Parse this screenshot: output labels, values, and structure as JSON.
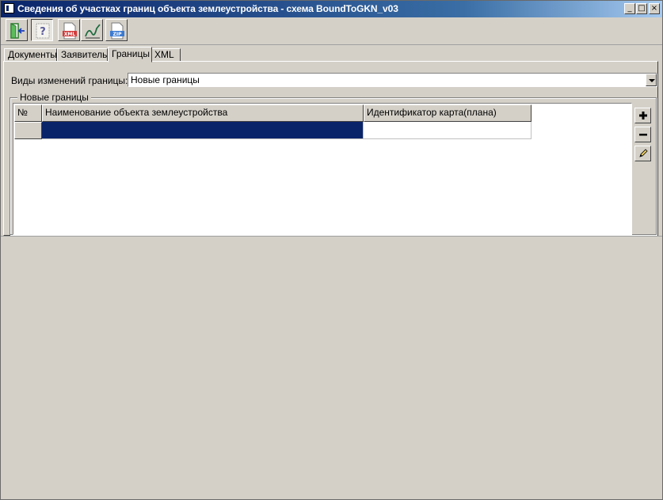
{
  "window": {
    "title": "Сведения об участках границ объекта землеустройства - схема BoundToGKN_v03",
    "controls": {
      "minimize": "_",
      "maximize": "□",
      "close": "×"
    }
  },
  "toolbar": {
    "buttons": [
      {
        "icon": "exit-door-icon"
      },
      {
        "icon": "help-icon"
      },
      {
        "icon": "xml-file-icon",
        "badge": "XML"
      },
      {
        "icon": "sign-icon"
      },
      {
        "icon": "zip-file-icon",
        "badge": "ZIP"
      }
    ]
  },
  "tabs": [
    {
      "label": "Документы"
    },
    {
      "label": "Заявитель"
    },
    {
      "label": "Границы",
      "active": true
    },
    {
      "label": "XML"
    }
  ],
  "form": {
    "kind_label": "Виды изменений границы:",
    "kind_value": "Новые границы",
    "group_title": "Новые границы"
  },
  "grid": {
    "columns": [
      "№",
      "Наименование объекта землеустройства",
      "Идентификатор карта(плана)"
    ],
    "rows": [
      {
        "num": "",
        "name": "",
        "id": "",
        "selected": true
      }
    ]
  },
  "side_buttons": [
    {
      "icon": "add-icon"
    },
    {
      "icon": "remove-icon"
    },
    {
      "icon": "edit-pencil-icon"
    }
  ],
  "colors": {
    "selection": "#0a246a",
    "face": "#d4d0c8"
  }
}
